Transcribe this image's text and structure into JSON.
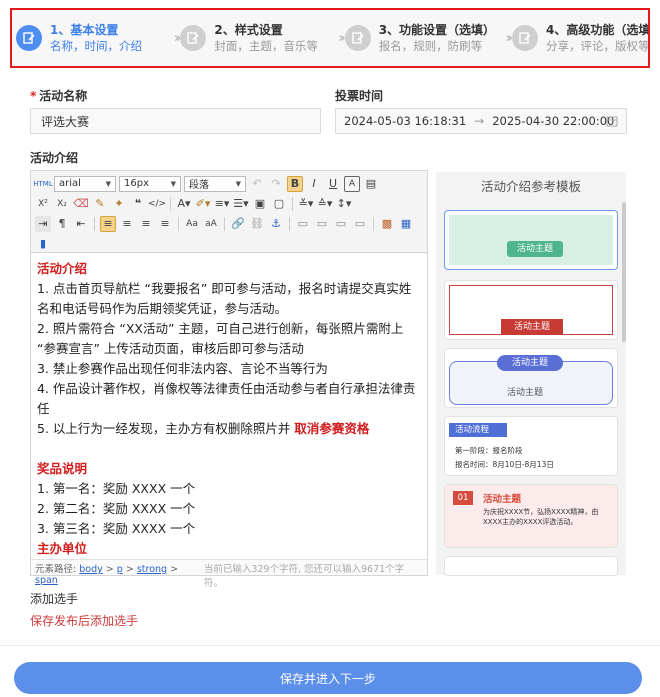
{
  "steps": [
    {
      "title": "1、基本设置",
      "sub": "名称，时间，介绍"
    },
    {
      "title": "2、样式设置",
      "sub": "封面，主题，音乐等"
    },
    {
      "title": "3、功能设置（选填）",
      "sub": "报名，规则，防刷等"
    },
    {
      "title": "4、高级功能（选填）",
      "sub": "分享，评论，版权等"
    }
  ],
  "form": {
    "name_label": "活动名称",
    "name_value": "评选大赛",
    "time_label": "投票时间",
    "start_time": "2024-05-03 16:18:31",
    "time_arrow": "→",
    "end_time": "2025-04-30 22:00:00",
    "intro_label": "活动介绍"
  },
  "toolbar": {
    "font": "arial",
    "size": "16px",
    "paragraph": "段落"
  },
  "content": {
    "h1": "活动介绍",
    "items": [
      "1. 点击首页导航栏 “我要报名” 即可参与活动，报名时请提交真实姓名和电话号码作为后期领奖凭证，参与活动。",
      "2. 照片需符合 “XX活动” 主题，可自己进行创新，每张照片需附上 “参赛宣言” 上传活动页面，审核后即可参与活动",
      "3. 禁止参赛作品出现任何非法内容、言论不当等行为",
      "4. 作品设计著作权，肖像权等法律责任由活动参与者自行承担法律责任"
    ],
    "item5_pre": "5. 以上行为一经发现，主办方有权删除照片并 ",
    "item5_red": "取消参赛资格",
    "h2": "奖品说明",
    "prizes": [
      "1. 第一名：奖励 XXXX 一个",
      "2. 第二名：奖励 XXXX 一个",
      "3. 第三名：奖励 XXXX 一个"
    ],
    "h3": "主办单位"
  },
  "pathbar": {
    "prefix": "元素路径:",
    "p1": "body",
    "sep": ">",
    "p2": "p",
    "p3": "strong",
    "p4": "span",
    "count": "当前已输入329个字符, 您还可以输入9671个字符。"
  },
  "templates": {
    "title": "活动介绍参考模板",
    "t1": "活动主题",
    "t2": "活动主题",
    "t3a": "活动主题",
    "t3b": "活动主题",
    "t4_tag": "活动流程",
    "t4_l1": "第一阶段：报名阶段",
    "t4_l2": "报名时间：8月10日-8月13日",
    "t5_num": "01",
    "t5_title": "活动主题",
    "t5_text": "为庆祝XXXX节，弘扬XXXX精神，由XXXX主办的XXXX评选活动。"
  },
  "add_label": "添加选手",
  "add_link": "保存发布后添加选手",
  "submit_label": "保存并进入下一步",
  "colors": {
    "accent": "#5b8fe9",
    "red": "#d11d1d",
    "highlight": "#e01b1b"
  }
}
